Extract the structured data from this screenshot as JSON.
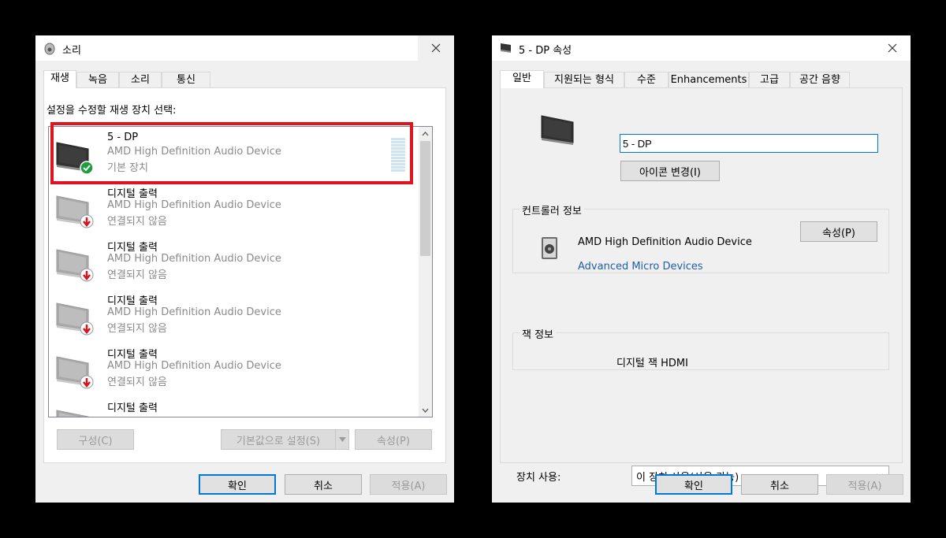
{
  "left_dialog": {
    "title": "소리",
    "tabs": [
      "재생",
      "녹음",
      "소리",
      "통신"
    ],
    "instruction": "설정을 수정할 재생 장치 선택:",
    "devices": [
      {
        "name": "5 - DP",
        "desc": "AMD High Definition Audio Device",
        "status": "기본 장치"
      },
      {
        "name": "디지털 출력",
        "desc": "AMD High Definition Audio Device",
        "status": "연결되지 않음"
      },
      {
        "name": "디지털 출력",
        "desc": "AMD High Definition Audio Device",
        "status": "연결되지 않음"
      },
      {
        "name": "디지털 출력",
        "desc": "AMD High Definition Audio Device",
        "status": "연결되지 않음"
      },
      {
        "name": "디지털 출력",
        "desc": "AMD High Definition Audio Device",
        "status": "연결되지 않음"
      },
      {
        "name": "디지털 출력",
        "desc": "",
        "status": ""
      }
    ],
    "buttons": {
      "configure": "구성(C)",
      "set_default": "기본값으로 설정(S)",
      "properties": "속성(P)",
      "ok": "확인",
      "cancel": "취소",
      "apply": "적용(A)"
    }
  },
  "right_dialog": {
    "title": "5 - DP 속성",
    "tabs": [
      "일반",
      "지원되는 형식",
      "수준",
      "Enhancements",
      "고급",
      "공간 음향"
    ],
    "device_name_value": "5 - DP",
    "change_icon_button": "아이콘 변경(I)",
    "controller_group_label": "컨트롤러 정보",
    "controller_name": "AMD High Definition Audio Device",
    "controller_vendor": "Advanced Micro Devices",
    "controller_properties_button": "속성(P)",
    "jack_group_label": "잭 정보",
    "jack_value": "디지털 잭 HDMI",
    "device_usage_label": "장치 사용:",
    "device_usage_value": "이 장치 사용(사용 가능)",
    "buttons": {
      "ok": "확인",
      "cancel": "취소",
      "apply": "적용(A)"
    }
  },
  "colors": {
    "accent": "#0078d7",
    "selection_outline": "#e0141e",
    "default_check": "#1a9e3a",
    "disconnected_badge": "#d9141e"
  }
}
